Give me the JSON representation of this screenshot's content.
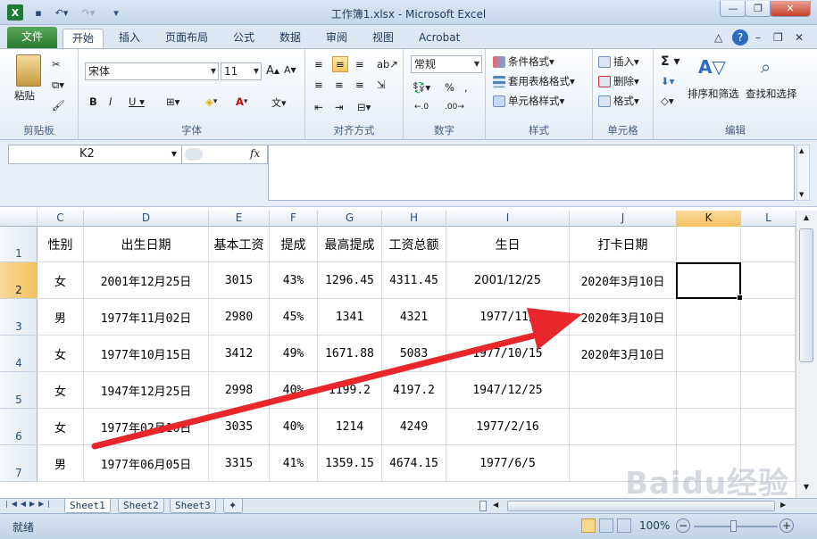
{
  "window": {
    "title": "工作簿1.xlsx  -  Microsoft Excel"
  },
  "tabs": [
    "文件",
    "开始",
    "插入",
    "页面布局",
    "公式",
    "数据",
    "审阅",
    "视图",
    "Acrobat"
  ],
  "ribbon": {
    "clipboard": {
      "paste": "粘贴",
      "label": "剪贴板"
    },
    "font": {
      "name": "宋体",
      "size": "11",
      "label": "字体"
    },
    "alignment": {
      "label": "对齐方式"
    },
    "number": {
      "format": "常规",
      "label": "数字"
    },
    "styles": {
      "cond": "条件格式",
      "table": "套用表格格式",
      "cell": "单元格样式",
      "label": "样式"
    },
    "cells": {
      "insert": "插入",
      "delete": "删除",
      "format": "格式",
      "label": "单元格"
    },
    "editing": {
      "sort": "排序和筛选",
      "find": "查找和选择",
      "label": "编辑"
    }
  },
  "namebox": "K2",
  "fx": "fx",
  "columns": [
    "C",
    "D",
    "E",
    "F",
    "G",
    "H",
    "I",
    "J",
    "K",
    "L"
  ],
  "rows": [
    "1",
    "2",
    "3",
    "4",
    "5",
    "6",
    "7"
  ],
  "headers": [
    "性别",
    "出生日期",
    "基本工资",
    "提成",
    "最高提成",
    "工资总额",
    "生日",
    "打卡日期"
  ],
  "data": [
    [
      "女",
      "2001年12月25日",
      "3015",
      "43%",
      "1296.45",
      "4311.45",
      "2001/12/25",
      "2020年3月10日"
    ],
    [
      "男",
      "1977年11月02日",
      "2980",
      "45%",
      "1341",
      "4321",
      "1977/11/",
      "2020年3月10日"
    ],
    [
      "女",
      "1977年10月15日",
      "3412",
      "49%",
      "1671.88",
      "5083",
      "1977/10/15",
      "2020年3月10日"
    ],
    [
      "女",
      "1947年12月25日",
      "2998",
      "40%",
      "1199.2",
      "4197.2",
      "1947/12/25",
      ""
    ],
    [
      "女",
      "1977年02月16日",
      "3035",
      "40%",
      "1214",
      "4249",
      "1977/2/16",
      ""
    ],
    [
      "男",
      "1977年06月05日",
      "3315",
      "41%",
      "1359.15",
      "4674.15",
      "1977/6/5",
      ""
    ]
  ],
  "sheets": [
    "Sheet1",
    "Sheet2",
    "Sheet3"
  ],
  "status": {
    "ready": "就绪",
    "zoom": "100%"
  },
  "watermark": "Baidu经验",
  "colors": {
    "arrow": "#e8262b",
    "file_tab": "#2e7d32",
    "selected_header": "#f3c76b"
  }
}
